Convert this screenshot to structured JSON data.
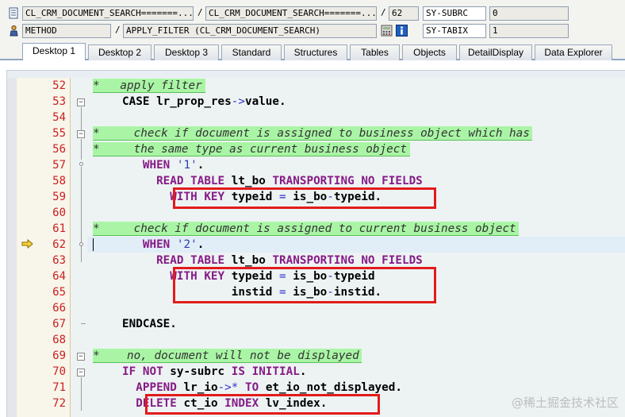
{
  "header": {
    "row1": {
      "program_field": "CL_CRM_DOCUMENT_SEARCH=======...",
      "include_field": "CL_CRM_DOCUMENT_SEARCH=======...",
      "line_field": "62",
      "var1_name": "SY-SUBRC",
      "var1_value": "0",
      "sep": "/"
    },
    "row2": {
      "type_field": "METHOD",
      "event_field": "APPLY_FILTER (CL_CRM_DOCUMENT_SEARCH)",
      "var2_name": "SY-TABIX",
      "var2_value": "1",
      "sep": "/"
    }
  },
  "tabs": [
    {
      "label": "Desktop 1",
      "active": true
    },
    {
      "label": "Desktop 2",
      "active": false
    },
    {
      "label": "Desktop 3",
      "active": false
    },
    {
      "label": "Standard",
      "active": false
    },
    {
      "label": "Structures",
      "active": false
    },
    {
      "label": "Tables",
      "active": false
    },
    {
      "label": "Objects",
      "active": false
    },
    {
      "label": "DetailDisplay",
      "active": false
    },
    {
      "label": "Data Explorer",
      "active": false
    }
  ],
  "code": {
    "current_line": "62",
    "lines": [
      {
        "no": "52",
        "tokens": [
          [
            "cm",
            "*   apply filter"
          ]
        ]
      },
      {
        "no": "53",
        "tokens": [
          [
            "id",
            "     CASE lr_prop_res"
          ],
          [
            "op",
            "->"
          ],
          [
            "id",
            "value."
          ]
        ]
      },
      {
        "no": "54",
        "tokens": []
      },
      {
        "no": "55",
        "tokens": [
          [
            "cm",
            "*     check if document is assigned to business object which has"
          ]
        ]
      },
      {
        "no": "56",
        "tokens": [
          [
            "cm",
            "*     the same type as current business object"
          ]
        ]
      },
      {
        "no": "57",
        "tokens": [
          [
            "kw",
            "        WHEN "
          ],
          [
            "lit",
            "'1'"
          ],
          [
            "id",
            "."
          ]
        ]
      },
      {
        "no": "58",
        "tokens": [
          [
            "kw",
            "          READ TABLE "
          ],
          [
            "id",
            "lt_bo "
          ],
          [
            "kw",
            "TRANSPORTING NO FIELDS"
          ]
        ]
      },
      {
        "no": "59",
        "tokens": [
          [
            "kw",
            "            WITH KEY "
          ],
          [
            "id",
            "typeid "
          ],
          [
            "op",
            "="
          ],
          [
            "id",
            " is_bo"
          ],
          [
            "op",
            "-"
          ],
          [
            "id",
            "typeid."
          ]
        ]
      },
      {
        "no": "60",
        "tokens": []
      },
      {
        "no": "61",
        "tokens": [
          [
            "cm",
            "*     check if document is assigned to current business object"
          ]
        ]
      },
      {
        "no": "62",
        "tokens": [
          [
            "kw",
            "        WHEN "
          ],
          [
            "lit",
            "'2'"
          ],
          [
            "id",
            "."
          ]
        ]
      },
      {
        "no": "63",
        "tokens": [
          [
            "kw",
            "          READ TABLE "
          ],
          [
            "id",
            "lt_bo "
          ],
          [
            "kw",
            "TRANSPORTING NO FIELDS"
          ]
        ]
      },
      {
        "no": "64",
        "tokens": [
          [
            "kw",
            "            WITH KEY "
          ],
          [
            "id",
            "typeid "
          ],
          [
            "op",
            "="
          ],
          [
            "id",
            " is_bo"
          ],
          [
            "op",
            "-"
          ],
          [
            "id",
            "typeid"
          ]
        ]
      },
      {
        "no": "65",
        "tokens": [
          [
            "id",
            "                     instid "
          ],
          [
            "op",
            "="
          ],
          [
            "id",
            " is_bo"
          ],
          [
            "op",
            "-"
          ],
          [
            "id",
            "instid."
          ]
        ]
      },
      {
        "no": "66",
        "tokens": []
      },
      {
        "no": "67",
        "tokens": [
          [
            "id",
            "     ENDCASE."
          ]
        ]
      },
      {
        "no": "68",
        "tokens": []
      },
      {
        "no": "69",
        "tokens": [
          [
            "cm",
            "*    no, document will not be displayed"
          ]
        ]
      },
      {
        "no": "70",
        "tokens": [
          [
            "kw",
            "     IF NOT "
          ],
          [
            "id",
            "sy-subrc "
          ],
          [
            "kw",
            "IS INITIAL"
          ],
          [
            "id",
            "."
          ]
        ]
      },
      {
        "no": "71",
        "tokens": [
          [
            "kw",
            "       APPEND "
          ],
          [
            "id",
            "lr_io"
          ],
          [
            "op",
            "->*"
          ],
          [
            "kw",
            " TO "
          ],
          [
            "id",
            "et_io_not_displayed."
          ]
        ]
      },
      {
        "no": "72",
        "tokens": [
          [
            "kw",
            "       DELETE "
          ],
          [
            "id",
            "ct_io "
          ],
          [
            "kw",
            "INDEX "
          ],
          [
            "id",
            "lv_index."
          ]
        ]
      }
    ]
  },
  "watermark": "@稀土掘金技术社区",
  "colors": {
    "comment_bg": "#a9f5a5",
    "keyword": "#861b86",
    "line_number": "#cc1f1f",
    "highlight_box": "#e31b1b"
  }
}
